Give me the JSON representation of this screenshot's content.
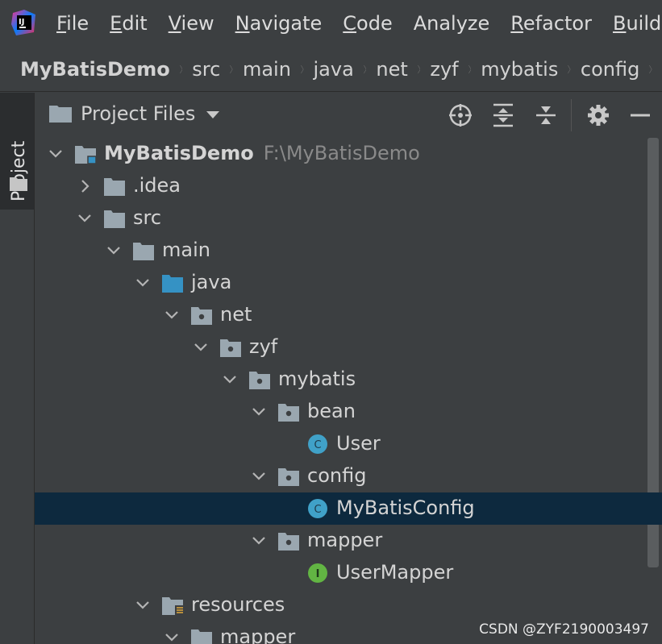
{
  "menubar": {
    "items": [
      "File",
      "Edit",
      "View",
      "Navigate",
      "Code",
      "Analyze",
      "Refactor",
      "Build"
    ],
    "mnemonics": [
      0,
      0,
      0,
      0,
      0,
      -1,
      0,
      0
    ]
  },
  "breadcrumb": [
    "MyBatisDemo",
    "src",
    "main",
    "java",
    "net",
    "zyf",
    "mybatis",
    "config"
  ],
  "tool_window": {
    "tab_label": "Project"
  },
  "panel": {
    "title": "Project Files"
  },
  "tree": [
    {
      "label": "MyBatisDemo",
      "hint": "F:\\MyBatisDemo",
      "depth": 0,
      "arrow": "down",
      "icon": "module-folder",
      "bold": true
    },
    {
      "label": ".idea",
      "depth": 1,
      "arrow": "right",
      "icon": "folder"
    },
    {
      "label": "src",
      "depth": 1,
      "arrow": "down",
      "icon": "folder"
    },
    {
      "label": "main",
      "depth": 2,
      "arrow": "down",
      "icon": "folder"
    },
    {
      "label": "java",
      "depth": 3,
      "arrow": "down",
      "icon": "source-folder"
    },
    {
      "label": "net",
      "depth": 4,
      "arrow": "down",
      "icon": "package"
    },
    {
      "label": "zyf",
      "depth": 5,
      "arrow": "down",
      "icon": "package"
    },
    {
      "label": "mybatis",
      "depth": 6,
      "arrow": "down",
      "icon": "package"
    },
    {
      "label": "bean",
      "depth": 7,
      "arrow": "down",
      "icon": "package"
    },
    {
      "label": "User",
      "depth": 8,
      "arrow": "none",
      "icon": "class"
    },
    {
      "label": "config",
      "depth": 7,
      "arrow": "down",
      "icon": "package"
    },
    {
      "label": "MyBatisConfig",
      "depth": 8,
      "arrow": "none",
      "icon": "class",
      "selected": true
    },
    {
      "label": "mapper",
      "depth": 7,
      "arrow": "down",
      "icon": "package"
    },
    {
      "label": "UserMapper",
      "depth": 8,
      "arrow": "none",
      "icon": "interface"
    },
    {
      "label": "resources",
      "depth": 3,
      "arrow": "down",
      "icon": "resources-folder"
    },
    {
      "label": "mapper",
      "depth": 4,
      "arrow": "down",
      "icon": "folder"
    }
  ],
  "watermark": "CSDN @ZYF2190003497",
  "colors": {
    "background": "#3c3f41",
    "selection": "#0d293e",
    "folder": "#9aa7b0",
    "source_folder": "#3592c4",
    "class_icon": "#40a1c8",
    "interface_icon": "#62b543"
  },
  "icons": {
    "logo": "intellij-logo-icon",
    "panel_tools": [
      "locate-icon",
      "expand-all-icon",
      "collapse-all-icon",
      "gear-icon",
      "minimize-icon"
    ]
  }
}
